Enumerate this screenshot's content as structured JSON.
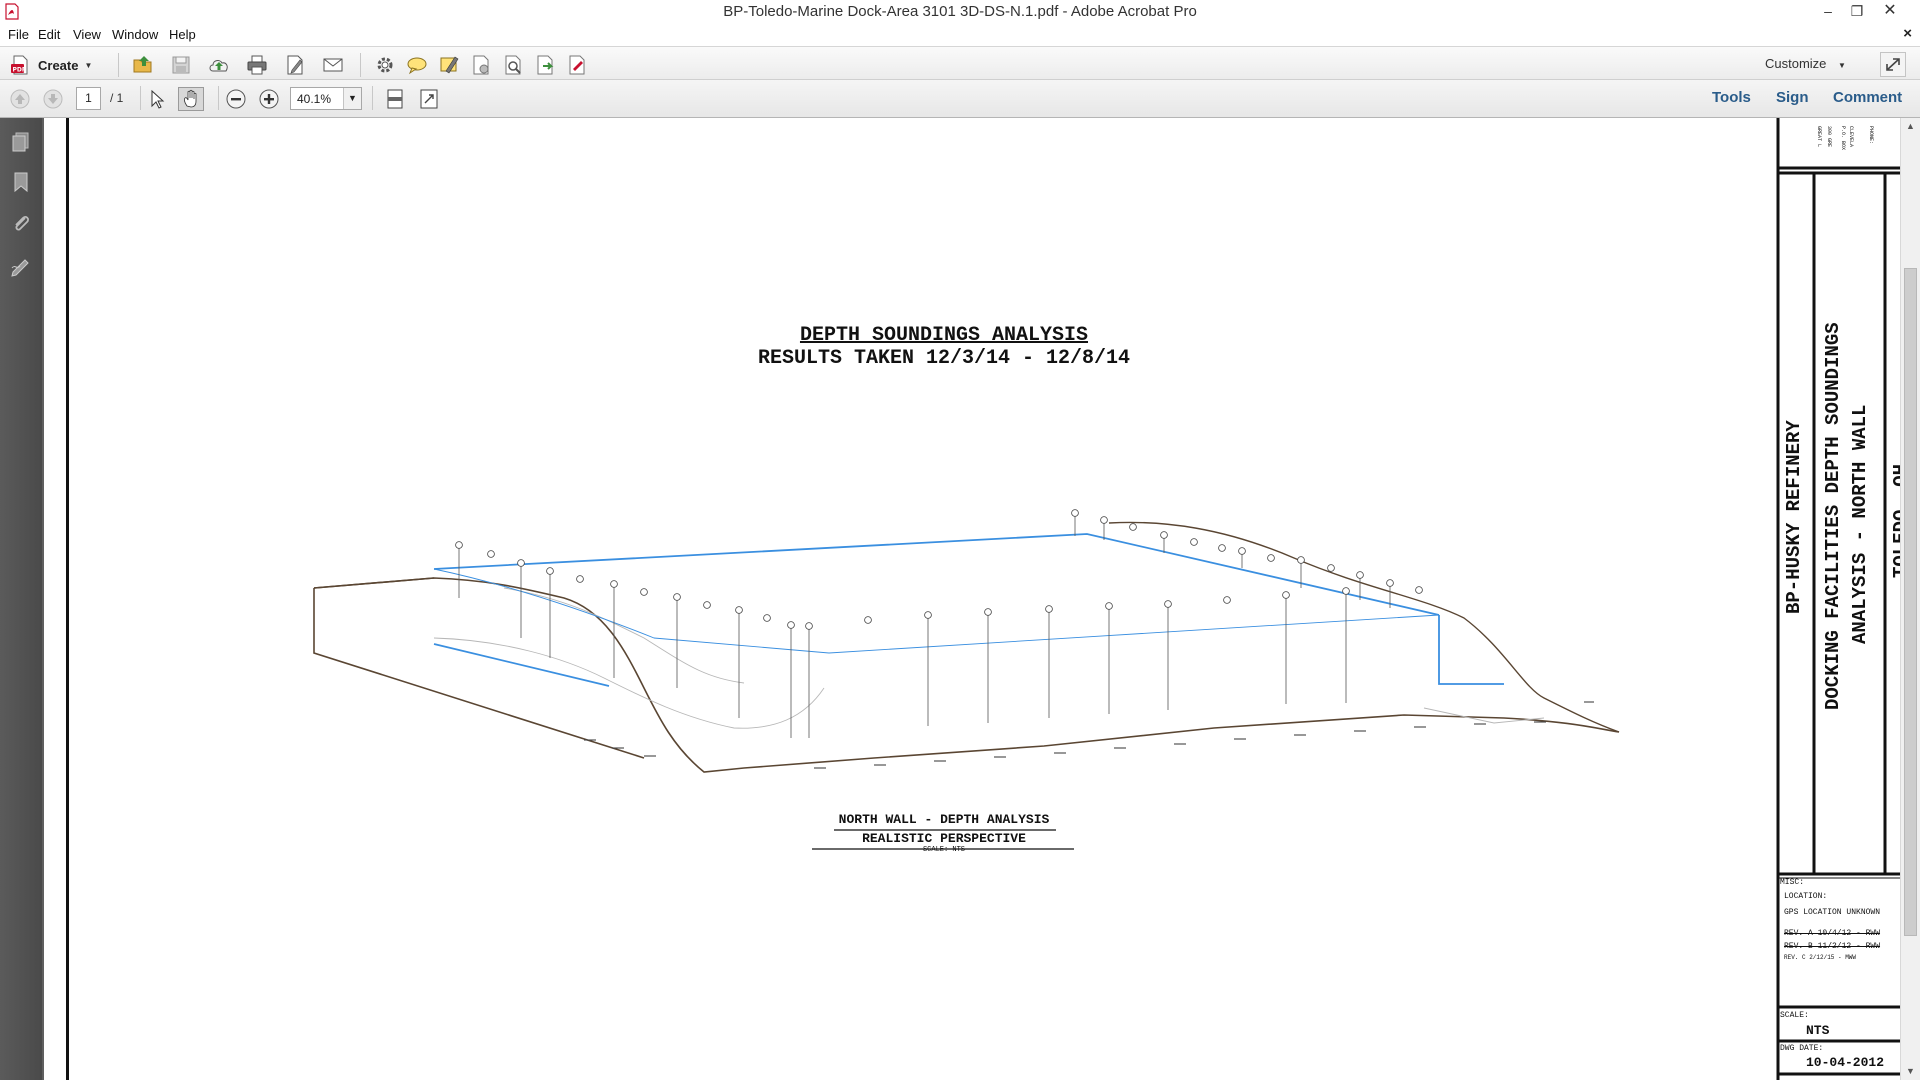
{
  "window": {
    "title": "BP-Toledo-Marine Dock-Area 3101 3D-DS-N.1.pdf - Adobe Acrobat Pro"
  },
  "menu": {
    "items": [
      "File",
      "Edit",
      "View",
      "Window",
      "Help"
    ]
  },
  "toolbar": {
    "create_label": "Create",
    "customize_label": "Customize"
  },
  "navigation": {
    "page_current": "1",
    "page_total": "/ 1",
    "zoom": "40.1%"
  },
  "panes": {
    "tools": "Tools",
    "sign": "Sign",
    "comment": "Comment"
  },
  "drawing": {
    "title_line1": "DEPTH SOUNDINGS ANALYSIS",
    "title_line2": "RESULTS TAKEN 12/3/14 - 12/8/14",
    "caption_line1": "NORTH WALL - DEPTH ANALYSIS",
    "caption_line2": "REALISTIC PERSPECTIVE",
    "caption_scale": "SCALE: NTS"
  },
  "title_block": {
    "company_col1": "GREAT L",
    "company_col2": "300 GRE",
    "company_col3": "P.O. BOX",
    "company_col4": "CLEVELA",
    "company_col5": "PHONE:",
    "client": "BP-HUSKY REFINERY",
    "project_line1": "DOCKING FACILITIES DEPTH SOUNDINGS",
    "project_line2": "ANALYSIS - NORTH WALL",
    "city": "TOLEDO, OH",
    "misc_label": "MISC:",
    "location_label": "LOCATION:",
    "location_value": "GPS LOCATION UNKNOWN",
    "rev_a": "REV. A 10/4/12 - RWW",
    "rev_b": "REV. B 11/2/12 - RWW",
    "rev_c": "REV. C 2/12/15 - MWW",
    "scale_label": "SCALE:",
    "scale_value": "NTS",
    "date_label": "DWG DATE:",
    "date_value": "10-04-2012"
  },
  "colors": {
    "accent": "#2a5c8a",
    "drawing_blue": "#3a8fe0",
    "terrain_brown": "#5a4633"
  }
}
